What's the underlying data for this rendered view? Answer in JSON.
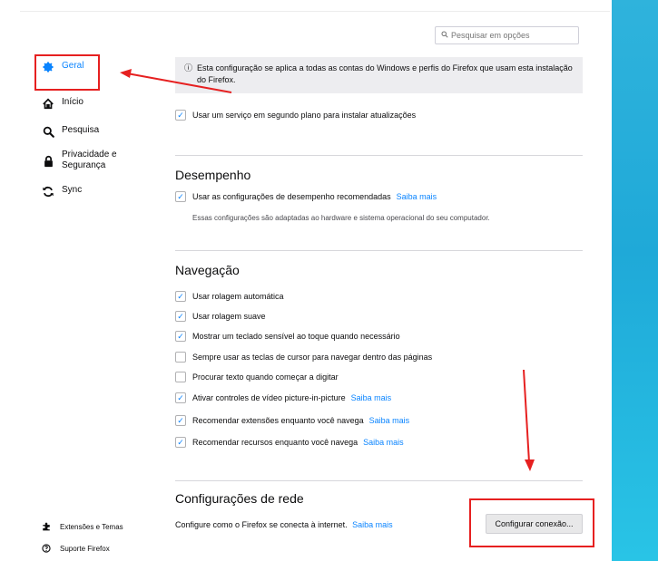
{
  "sidebar": {
    "items": [
      {
        "label": "Geral",
        "icon": "gear-icon"
      },
      {
        "label": "Início",
        "icon": "home-icon"
      },
      {
        "label": "Pesquisa",
        "icon": "search-icon"
      },
      {
        "label": "Privacidade e\nSegurança",
        "icon": "lock-icon"
      },
      {
        "label": "Sync",
        "icon": "sync-icon"
      }
    ],
    "footer": [
      {
        "label": "Extensões e Temas",
        "icon": "puzzle-icon"
      },
      {
        "label": "Suporte Firefox",
        "icon": "help-icon"
      }
    ]
  },
  "search": {
    "placeholder": "Pesquisar em opções"
  },
  "info": {
    "text": "Esta configuração se aplica a todas as contas do Windows e perfis do Firefox que usam esta instalação do Firefox."
  },
  "updates": {
    "background_service": "Usar um serviço em segundo plano para instalar atualizações"
  },
  "performance": {
    "heading": "Desempenho",
    "recommended": "Usar as configurações de desempenho recomendadas",
    "learn_more": "Saiba mais",
    "description": "Essas configurações são adaptadas ao hardware e sistema operacional do seu computador."
  },
  "navigation": {
    "heading": "Navegação",
    "options": [
      {
        "label": "Usar rolagem automática",
        "checked": true
      },
      {
        "label": "Usar rolagem suave",
        "checked": true
      },
      {
        "label": "Mostrar um teclado sensível ao toque quando necessário",
        "checked": true
      },
      {
        "label": "Sempre usar as teclas de cursor para navegar dentro das páginas",
        "checked": false
      },
      {
        "label": "Procurar texto quando começar a digitar",
        "checked": false
      },
      {
        "label": "Ativar controles de vídeo picture-in-picture",
        "checked": true,
        "link": "Saiba mais"
      },
      {
        "label": "Recomendar extensões enquanto você navega",
        "checked": true,
        "link": "Saiba mais"
      },
      {
        "label": "Recomendar recursos enquanto você navega",
        "checked": true,
        "link": "Saiba mais"
      }
    ]
  },
  "network": {
    "heading": "Configurações de rede",
    "text": "Configure como o Firefox se conecta à internet.",
    "learn_more": "Saiba mais",
    "button": "Configurar conexão..."
  },
  "colors": {
    "accent": "#0a84ff",
    "annotation": "#e62020",
    "strip": "#1fa9d8"
  }
}
